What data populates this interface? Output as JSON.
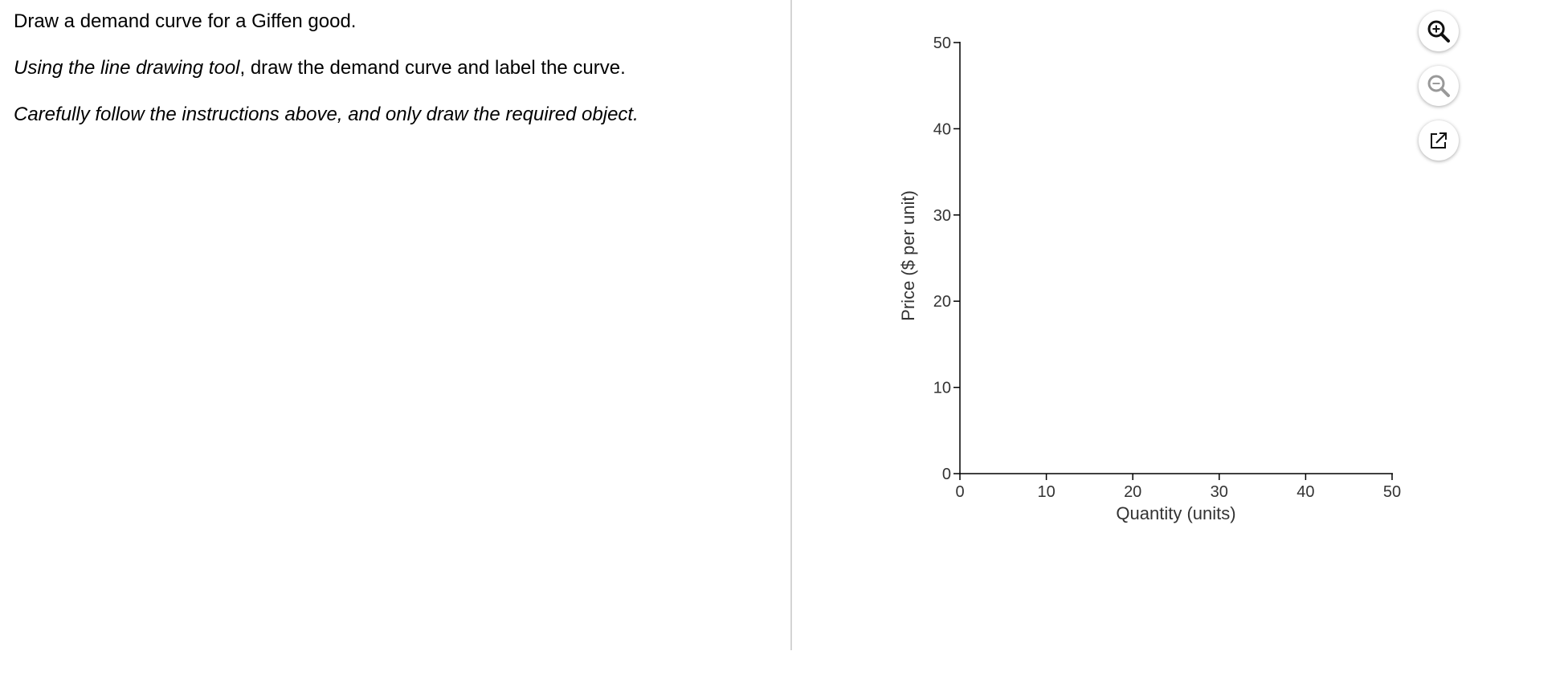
{
  "instructions": {
    "line1": "Draw a demand curve for a Giffen good.",
    "line2_italic": "Using the line drawing tool",
    "line2_rest": ", draw the demand curve and label the curve.",
    "line3": "Carefully follow the instructions above, and only draw the required object."
  },
  "toolbar": {
    "zoom_in": "zoom-in-icon",
    "zoom_out": "zoom-out-icon",
    "popout": "popout-icon"
  },
  "chart_data": {
    "type": "line",
    "title": "",
    "xlabel": "Quantity (units)",
    "ylabel": "Price ($ per unit)",
    "xlim": [
      0,
      50
    ],
    "ylim": [
      0,
      50
    ],
    "xticks": [
      0,
      10,
      20,
      30,
      40,
      50
    ],
    "yticks": [
      0,
      10,
      20,
      30,
      40,
      50
    ],
    "grid": false,
    "series": []
  },
  "colors": {
    "axis": "#000000",
    "tick_label": "#333333",
    "zoom_in_icon": "#111111",
    "zoom_out_icon": "#999999",
    "popout_icon": "#111111"
  }
}
